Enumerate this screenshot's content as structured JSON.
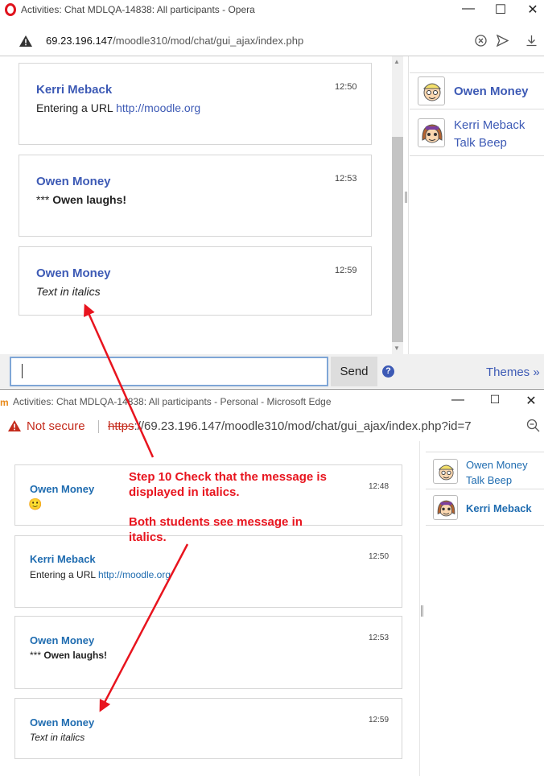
{
  "window1": {
    "title": "Activities: Chat MDLQA-14838: All participants - Opera",
    "url_host": "69.23.196.147",
    "url_path": "/moodle310/mod/chat/gui_ajax/index.php",
    "messages": [
      {
        "user": "Kerri Meback",
        "time": "12:50",
        "text_prefix": "Entering a URL ",
        "link": "http://moodle.org"
      },
      {
        "user": "Owen Money",
        "time": "12:53",
        "text_prefix": "*** ",
        "bold": "Owen laughs!"
      },
      {
        "user": "Owen Money",
        "time": "12:59",
        "italic": "Text in italics"
      }
    ],
    "users": [
      {
        "name": "Owen Money",
        "sub": ""
      },
      {
        "name": "Kerri Meback",
        "sub": "Talk Beep"
      }
    ],
    "send_label": "Send",
    "help_icon": "?",
    "themes_label": "Themes »"
  },
  "window2": {
    "title": "Activities: Chat MDLQA-14838: All participants - Personal - Microsoft Edge",
    "not_secure": "Not secure",
    "url_scheme": "https",
    "url_rest": "://69.23.196.147/moodle310/mod/chat/gui_ajax/index.php?id=7",
    "messages": [
      {
        "user": "Owen Money",
        "time": "12:48",
        "emoji": "🙂"
      },
      {
        "user": "Kerri Meback",
        "time": "12:50",
        "text_prefix": "Entering a URL ",
        "link": "http://moodle.org"
      },
      {
        "user": "Owen Money",
        "time": "12:53",
        "text_prefix": "*** ",
        "bold": "Owen laughs!"
      },
      {
        "user": "Owen Money",
        "time": "12:59",
        "italic": "Text in italics"
      }
    ],
    "users": [
      {
        "name": "Owen Money",
        "sub": "Talk Beep"
      },
      {
        "name": "Kerri Meback",
        "sub": ""
      }
    ]
  },
  "annotation": {
    "line1": "Step 10 Check that the message is",
    "line2": "displayed in italics.",
    "line3": "Both students see message in",
    "line4": "italics."
  },
  "colors": {
    "arrow": "#e8141e",
    "username_opera": "#3d5ab5",
    "username_edge": "#1f6cb0"
  }
}
